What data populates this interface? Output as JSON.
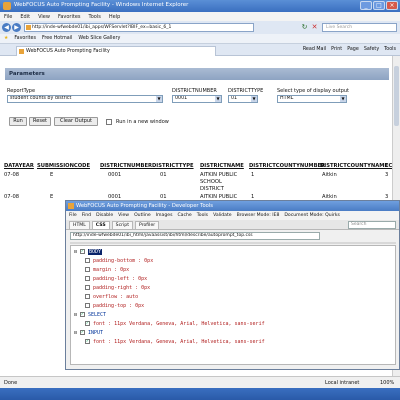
{
  "window": {
    "title": "WebFOCUS Auto Prompting Facility - Windows Internet Explorer",
    "controls": [
      "_",
      "□",
      "×"
    ]
  },
  "menu": [
    "File",
    "Edit",
    "View",
    "Favorites",
    "Tools",
    "Help"
  ],
  "address": {
    "url": "http://inde-wfwebde01/ibi_apps/WFServlet?IBIF_ex=basic_6_1",
    "search_placeholder": "Live Search"
  },
  "favorites": {
    "label": "Favorites",
    "items": [
      "Free Hotmail",
      "Web Slice Gallery"
    ]
  },
  "tab": {
    "label": "WebFOCUS Auto Prompting Facility",
    "commands": [
      "Page",
      "Safety",
      "Tools",
      "Read Mail",
      "Print"
    ]
  },
  "params": {
    "header": "Parameters",
    "report_type_label": "ReportType",
    "report_type_value": "student counts by district",
    "district_number_label": "DISTRICTNUMBER",
    "district_number_value": "0001",
    "district_type_label": "DISTRICTTYPE",
    "district_type_value": "01",
    "display_label": "Select type of display output",
    "display_value": "HTML",
    "run_label": "Run",
    "reset_label": "Reset",
    "clear_label": "Clear Output",
    "new_window_label": "Run in a new window"
  },
  "report": {
    "headers": [
      "DATAYEAR",
      "SUBMISSIONCODE",
      "DISTRICTNUMBER",
      "DISTRICTTYPE",
      "DISTRICTNAME",
      "DISTRICTCOUNTYNUMBER",
      "DISTRICTCOUNTYNAME",
      "ECS"
    ],
    "rows": [
      [
        "07-08",
        "E",
        "0001",
        "01",
        "AITKIN PUBLIC SCHOOL DISTRICT",
        "1",
        "Aitkin",
        "3"
      ],
      [
        "07-08",
        "E",
        "0001",
        "01",
        "AITKIN PUBLIC",
        "1",
        "Aitkin",
        "3"
      ]
    ]
  },
  "devtools": {
    "title": "WebFOCUS Auto Prompting Facility - Developer Tools",
    "menu": [
      "File",
      "Find",
      "Disable",
      "View",
      "Outline",
      "Images",
      "Cache",
      "Tools",
      "Validate",
      "Browser Mode: IE8",
      "Document Mode: Quirks"
    ],
    "tabs": [
      "HTML",
      "CSS",
      "Script",
      "Profiler"
    ],
    "active_tab": "CSS",
    "search_placeholder": "Search",
    "stylesheet_url": "http://inde-wfwebde01/ibi_html/javaassist/ibi/html/describe/autoprompt_top.css",
    "rules": [
      {
        "kind": "selector",
        "text": "BODY",
        "highlight": true,
        "checked": true
      },
      {
        "kind": "prop",
        "text": "padding-bottom : 0px",
        "checked": false
      },
      {
        "kind": "prop",
        "text": "margin : 0px",
        "checked": false
      },
      {
        "kind": "prop",
        "text": "padding-left : 0px",
        "checked": false
      },
      {
        "kind": "prop",
        "text": "padding-right : 0px",
        "checked": false
      },
      {
        "kind": "prop",
        "text": "overflow : auto",
        "checked": false
      },
      {
        "kind": "prop",
        "text": "padding-top : 0px",
        "checked": false
      },
      {
        "kind": "selector",
        "text": "SELECT",
        "highlight": false,
        "checked": true
      },
      {
        "kind": "prop",
        "text": "font : 11px Verdana, Geneva, Arial, Helvetica, sans-serif",
        "checked": true
      },
      {
        "kind": "selector",
        "text": "INPUT",
        "highlight": false,
        "checked": true
      },
      {
        "kind": "prop",
        "text": "font : 11px Verdana, Geneva, Arial, Helvetica, sans-serif",
        "checked": true
      }
    ]
  },
  "status": {
    "left": "Done",
    "zone": "Local intranet",
    "zoom": "100%"
  }
}
